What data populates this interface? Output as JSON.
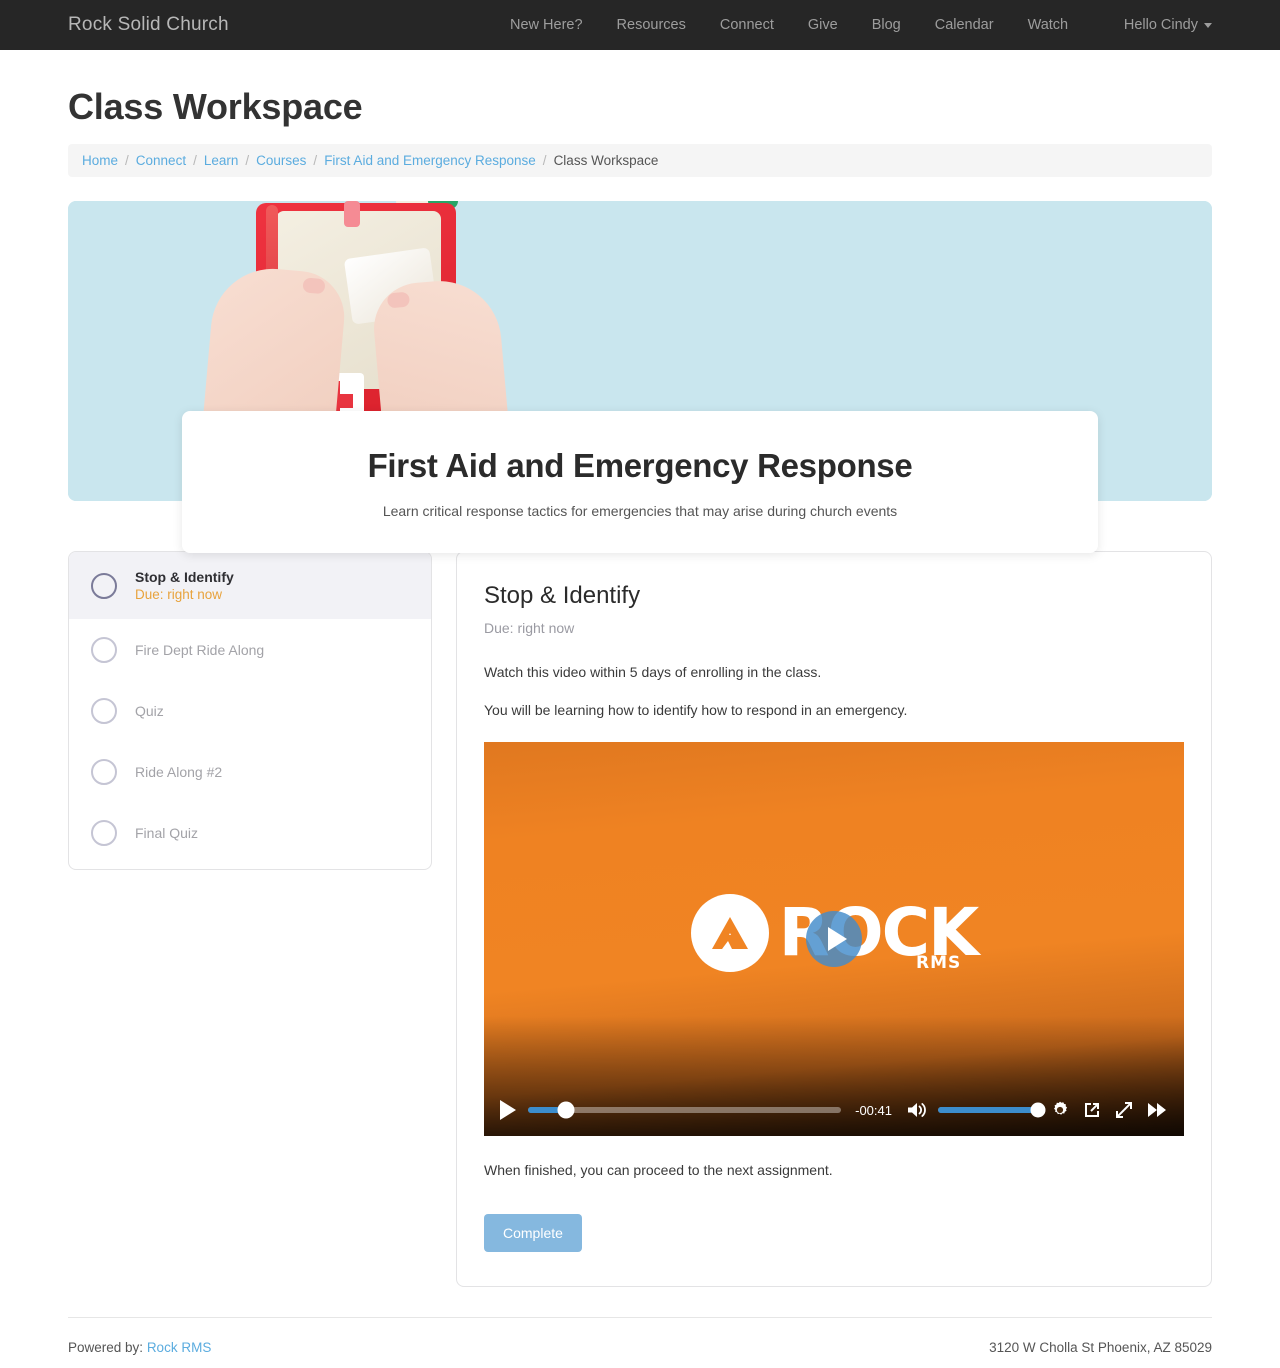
{
  "navbar": {
    "brand": "Rock Solid Church",
    "links": [
      {
        "label": "New Here?"
      },
      {
        "label": "Resources"
      },
      {
        "label": "Connect"
      },
      {
        "label": "Give"
      },
      {
        "label": "Blog"
      },
      {
        "label": "Calendar"
      },
      {
        "label": "Watch"
      }
    ],
    "user_label": "Hello Cindy",
    "background": "#262626"
  },
  "page": {
    "title": "Class Workspace"
  },
  "breadcrumb": {
    "items": [
      {
        "label": "Home",
        "link": true
      },
      {
        "label": "Connect",
        "link": true
      },
      {
        "label": "Learn",
        "link": true
      },
      {
        "label": "Courses",
        "link": true
      },
      {
        "label": "First Aid and Emergency Response",
        "link": true
      },
      {
        "label": "Class Workspace",
        "link": false
      }
    ],
    "separator": "/",
    "link_color": "#5bacdf"
  },
  "hero": {
    "image_alt": "hands holding an open red first aid kit on a light blue background",
    "background_color": "#c9e6ee",
    "title": "First Aid and Emergency Response",
    "subtitle": "Learn critical response tactics for emergencies that may arise during church events"
  },
  "activities": [
    {
      "name": "Stop & Identify",
      "due": "Due: right now",
      "state": "current"
    },
    {
      "name": "Fire Dept Ride Along",
      "due": "",
      "state": "pending"
    },
    {
      "name": "Quiz",
      "due": "",
      "state": "pending"
    },
    {
      "name": "Ride Along #2",
      "due": "",
      "state": "pending"
    },
    {
      "name": "Final Quiz",
      "due": "",
      "state": "pending"
    }
  ],
  "assignment": {
    "title": "Stop & Identify",
    "due": "Due: right now",
    "paragraph_1": "Watch this video within 5 days of enrolling in the class.",
    "paragraph_2": "You will be learning how to identify how to respond in an emergency.",
    "closing": "When finished, you can proceed to the next assignment.",
    "complete_label": "Complete",
    "complete_color": "#85b8df"
  },
  "video": {
    "logo_text": "ROCK",
    "logo_sub": "RMS",
    "time_remaining": "-00:41",
    "progress_percent": 12,
    "volume_percent": 100,
    "accent_color": "#3c8dcc",
    "background_color": "#ef8222"
  },
  "footer": {
    "powered_by_prefix": "Powered by:",
    "powered_by_link": "Rock RMS",
    "address": "3120 W Cholla St Phoenix, AZ 85029"
  }
}
